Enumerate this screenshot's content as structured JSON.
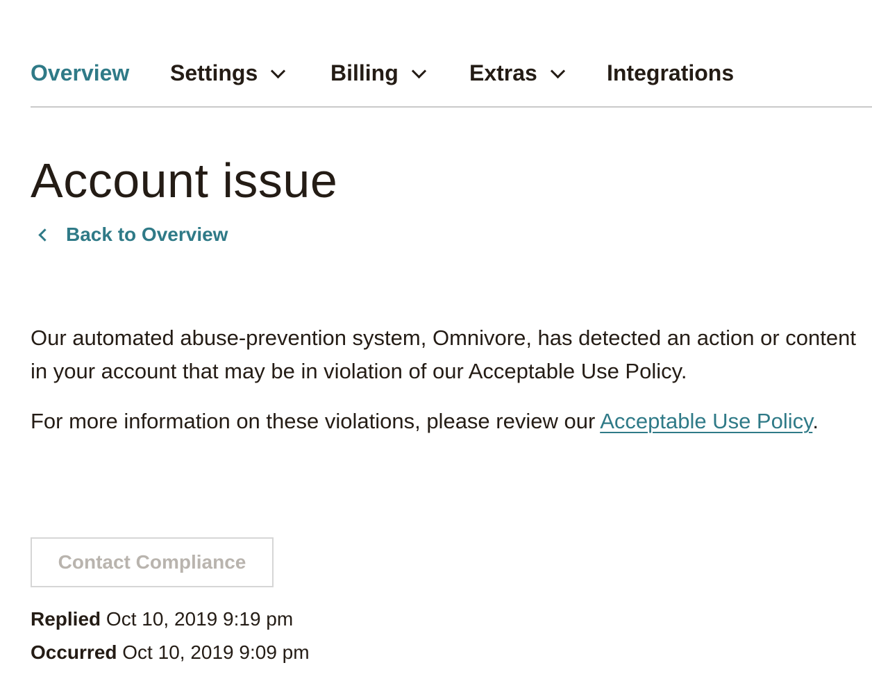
{
  "nav": {
    "items": [
      {
        "label": "Overview",
        "active": true,
        "has_dropdown": false
      },
      {
        "label": "Settings",
        "active": false,
        "has_dropdown": true
      },
      {
        "label": "Billing",
        "active": false,
        "has_dropdown": true
      },
      {
        "label": "Extras",
        "active": false,
        "has_dropdown": true
      },
      {
        "label": "Integrations",
        "active": false,
        "has_dropdown": false
      }
    ]
  },
  "page": {
    "title": "Account issue",
    "back_label": "Back to Overview"
  },
  "content": {
    "paragraph1": "Our automated abuse-prevention system, Omnivore, has detected an action or content in your account that may be in violation of our Acceptable Use Policy.",
    "paragraph2_prefix": "For more information on these violations, please review our ",
    "paragraph2_link": "Acceptable Use Policy",
    "paragraph2_suffix": "."
  },
  "actions": {
    "contact_label": "Contact Compliance",
    "contact_disabled": true
  },
  "meta": {
    "replied_label": "Replied",
    "replied_value": "Oct 10, 2019 9:19 pm",
    "occurred_label": "Occurred",
    "occurred_value": "Oct 10, 2019 9:09 pm"
  },
  "colors": {
    "accent": "#2f7a87",
    "text": "#241c15",
    "divider": "#c9c9c9",
    "disabled_text": "#b9b4ae"
  },
  "icons": {
    "dropdown": "chevron-down-icon",
    "back": "chevron-left-icon"
  }
}
